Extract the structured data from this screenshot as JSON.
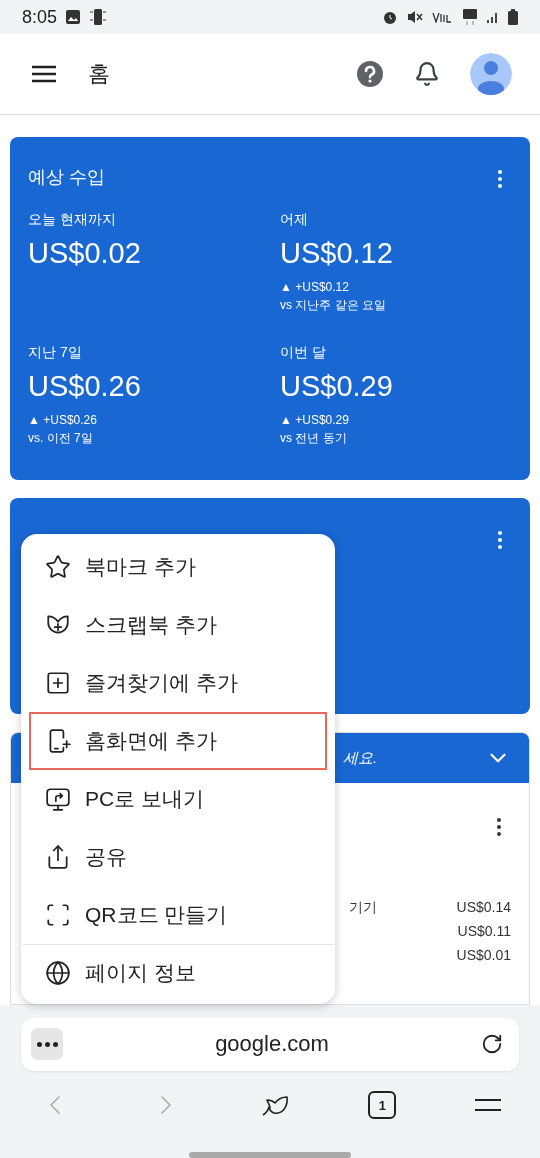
{
  "status_bar": {
    "time": "8:05"
  },
  "app_bar": {
    "title": "홈"
  },
  "earnings_card": {
    "title": "예상 수입",
    "metrics": [
      {
        "label": "오늘 현재까지",
        "value": "US$0.02"
      },
      {
        "label": "어제",
        "value": "US$0.12",
        "change": "▲ +US$0.12",
        "comparison": "vs 지난주 같은 요일"
      },
      {
        "label": "지난 7일",
        "value": "US$0.26",
        "change": "▲ +US$0.26",
        "comparison": "vs. 이전 7일"
      },
      {
        "label": "이번 달",
        "value": "US$0.29",
        "change": "▲ +US$0.29",
        "comparison": "vs 전년 동기"
      }
    ]
  },
  "notice_card": {
    "header_text": "세요.",
    "rows": [
      {
        "label": "기기",
        "amount": "US$0.14"
      },
      {
        "amount": "US$0.11"
      },
      {
        "amount": "US$0.01"
      }
    ]
  },
  "menu": {
    "items": [
      {
        "label": "북마크 추가",
        "highlighted": false,
        "separated": false
      },
      {
        "label": "스크랩북 추가",
        "highlighted": false,
        "separated": false
      },
      {
        "label": "즐겨찾기에 추가",
        "highlighted": false,
        "separated": false
      },
      {
        "label": "홈화면에 추가",
        "highlighted": true,
        "separated": false
      },
      {
        "label": "PC로 보내기",
        "highlighted": false,
        "separated": false
      },
      {
        "label": "공유",
        "highlighted": false,
        "separated": false
      },
      {
        "label": "QR코드 만들기",
        "highlighted": false,
        "separated": false
      },
      {
        "label": "페이지 정보",
        "highlighted": false,
        "separated": true
      }
    ]
  },
  "browser": {
    "url": "google.com",
    "tab_count": "1"
  }
}
